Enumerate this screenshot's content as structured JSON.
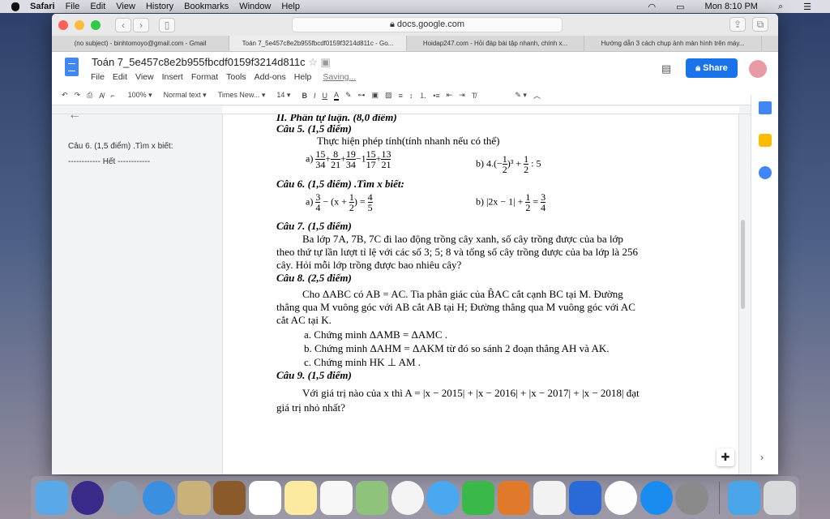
{
  "menubar": {
    "app": "Safari",
    "items": [
      "File",
      "Edit",
      "View",
      "History",
      "Bookmarks",
      "Window",
      "Help"
    ],
    "clock": "Mon 8:10 PM"
  },
  "browser": {
    "url": "docs.google.com",
    "tabs": [
      "(no subject) - binhtomoyo@gmail.com - Gmail",
      "Toán 7_5e457c8e2b955fbcdf0159f3214d811c - Go...",
      "Hoidap247.com - Hỏi đáp bài tập nhanh, chính x...",
      "Hướng dẫn 3 cách chụp ảnh màn hình trên máy..."
    ]
  },
  "doc": {
    "title": "Toán 7_5e457c8e2b955fbcdf0159f3214d811c",
    "menus": [
      "File",
      "Edit",
      "View",
      "Insert",
      "Format",
      "Tools",
      "Add-ons",
      "Help"
    ],
    "status": "Saving...",
    "share": "Share"
  },
  "toolbar": {
    "zoom": "100%",
    "style": "Normal text",
    "font": "Times New...",
    "size": "14"
  },
  "outline": {
    "item1": "Câu 6. (1,5 điểm) .Tìm x biết:",
    "item2": "------------ Hết ------------"
  },
  "body": {
    "section": "II. Phần tự luận. (8,0 điểm)",
    "c5": "Câu 5. (1,5 điểm)",
    "c5intro": "Thực hiện phép tính(tính nhanh nếu có thể)",
    "c6": "Câu 6. (1,5 điểm) .Tìm x biết:",
    "c7": "Câu 7. (1,5 điểm)",
    "c7l1": "Ba lớp 7A, 7B, 7C đi lao động trồng cây xanh, số cây trồng được của ba lớp",
    "c7l2": "theo thứ tự lần lượt tỉ lệ với các số 3; 5; 8 và tổng số cây trồng được của ba lớp là 256",
    "c7l3": "cây. Hỏi mỗi lớp trồng được bao nhiêu cây?",
    "c8": "Câu 8. (2,5 điểm)",
    "c8l1": "Cho ΔABC có AB = AC. Tia phân giác của B̂AC cắt cạnh BC tại M. Đường",
    "c8l2": "thẳng qua M vuông góc với AB cắt AB tại H; Đường thẳng qua M vuông góc với AC",
    "c8l3": "cắt AC tại K.",
    "c8a": "a. Chứng minh ΔAMB = ΔAMC .",
    "c8b": "b. Chứng minh ΔAHM = ΔAKM từ đó so sánh 2 đoạn thẳng AH và AK.",
    "c8c": "c. Chứng minh HK ⊥ AM .",
    "c9": "Câu 9. (1,5 điểm)",
    "c9l1": "Với giá trị nào của x thì A = |x − 2015| + |x − 2016| + |x − 2017| + |x − 2018|  đạt",
    "c9l2": "giá trị nhỏ nhất?"
  },
  "colors": {
    "share": "#1a73e8",
    "doc_icon": "#4285f4"
  }
}
